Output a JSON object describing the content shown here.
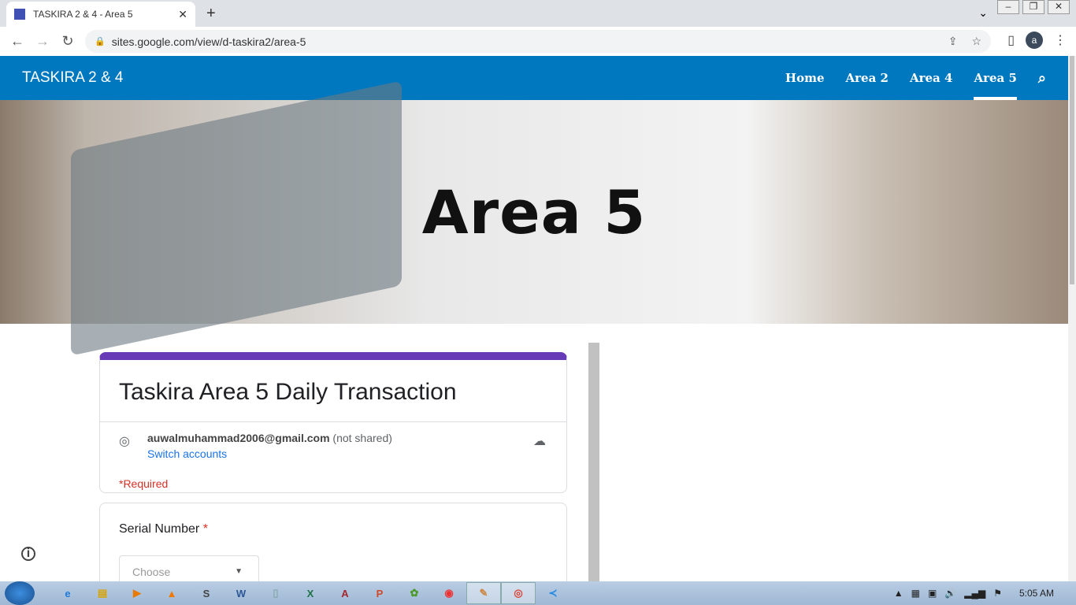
{
  "browser": {
    "tab_title": "TASKIRA 2 & 4 - Area 5",
    "url": "sites.google.com/view/d-taskira2/area-5",
    "profile_initial": "a"
  },
  "site": {
    "brand": "TASKIRA 2 & 4",
    "nav": [
      "Home",
      "Area 2",
      "Area 4",
      "Area 5"
    ],
    "active_nav": "Area 5",
    "hero_title": "Area 5",
    "accent": "#0078c0"
  },
  "form": {
    "title": "Taskira Area 5 Daily Transaction",
    "email": "auwalmuhammad2006@gmail.com",
    "not_shared": "(not shared)",
    "switch_accounts": "Switch accounts",
    "required_note": "*Required",
    "question": "Serial Number",
    "required_mark": "*",
    "select_placeholder": "Choose",
    "accent": "#673ab7"
  },
  "taskbar": {
    "time": "5:05 AM",
    "apps": [
      "ie",
      "explorer",
      "media-player",
      "vlc",
      "sublime",
      "word",
      "notepad",
      "excel",
      "access",
      "powerpoint",
      "greenshot",
      "app-red",
      "paint",
      "chrome",
      "vscode"
    ]
  }
}
